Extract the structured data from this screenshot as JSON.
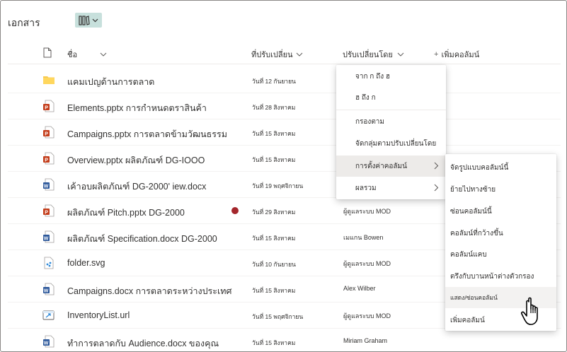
{
  "library": {
    "title": "เอกสาร"
  },
  "columns": {
    "name": "ชื่อ",
    "modified": "ที่ปรับเปลี่ยน",
    "modified_by": "ปรับเปลี่ยนโดย",
    "add_column": "เพิ่มคอลัมน์"
  },
  "rows": [
    {
      "name": "แคมเปญด้านการตลาด",
      "modified": "วันที่ 12 กันยายน",
      "modified_by": "",
      "type": "folder"
    },
    {
      "name": "Elements.pptx การกำหนดตราสินค้า",
      "modified": "วันที่ 28 สิงหาคม",
      "modified_by": "",
      "type": "pptx"
    },
    {
      "name": "Campaigns.pptx การตลาดข้ามวัฒนธรรม",
      "modified": "วันที่ 15 สิงหาคม",
      "modified_by": "",
      "type": "pptx"
    },
    {
      "name": "Overview.pptx ผลิตภัณฑ์ DG-IOOO",
      "modified": "วันที่ 15 สิงหาคม",
      "modified_by": "",
      "type": "pptx"
    },
    {
      "name": "เค้าอบผลิตภัณฑ์ DG-2000' iew.docx",
      "modified": "วันที่ 19 พฤศจิกายน",
      "modified_by": "",
      "type": "docx"
    },
    {
      "name": "ผลิตภัณฑ์ Pitch.pptx DG-2000",
      "modified": "วันที่ 29 สิงหาคม",
      "modified_by": "ผู้ดูแลระบบ MOD",
      "type": "pptx"
    },
    {
      "name": "ผลิตภัณฑ์ Specification.docx DG-2000",
      "modified": "วันที่ 15 สิงหาคม",
      "modified_by": "เมแกน Bowen",
      "type": "docx"
    },
    {
      "name": "folder.svg",
      "modified": "วันที่ 10 กันยายน",
      "modified_by": "ผู้ดูแลระบบ MOD",
      "type": "svg"
    },
    {
      "name": "Campaigns.docx การตลาดระหว่างประเทศ",
      "modified": "วันที่ 15 สิงหาคม",
      "modified_by": "Alex Wilber",
      "type": "docx"
    },
    {
      "name": "InventoryList.url",
      "modified": "วันที่ 15 พฤศจิกายน",
      "modified_by": "ผู้ดูแลระบบ MOD",
      "type": "url"
    },
    {
      "name": "ทำการตลาดกับ Audience.docx ของคุณ",
      "modified": "วันที่ 15 สิงหาคม",
      "modified_by": "Miriam Graham",
      "type": "docx"
    }
  ],
  "column_menu": {
    "sort_az": "จาก ก ถึง ฮ",
    "sort_za": "ฮ ถึง ก",
    "filter_by": "กรองตาม",
    "group_by": "จัดกลุ่มตามปรับเปลี่ยนโดย",
    "column_settings": "การตั้งค่าคอลัมน์",
    "totals": "ผลรวม"
  },
  "settings_submenu": {
    "format": "จัดรูปแบบคอลัมน์นี้",
    "move_left": "ย้ายไปทางซ้าย",
    "hide": "ซ่อนคอลัมน์นี้",
    "wider": "คอลัมน์ที่กว้างขึ้น",
    "narrower": "คอลัมน์แคบ",
    "pin_filter": "ตรึงกับบานหน้าต่างตัวกรอง",
    "show_hide": "แสดง/ซ่อนคอลัมน์",
    "add_column": "เพิ่มคอลัมน์"
  },
  "colors": {
    "accent_view": "#c7e0dc",
    "ppt_red": "#c43e1c",
    "word_blue": "#2b579a",
    "folder_yellow": "#f8c94d",
    "alert_red": "#a4262c"
  }
}
